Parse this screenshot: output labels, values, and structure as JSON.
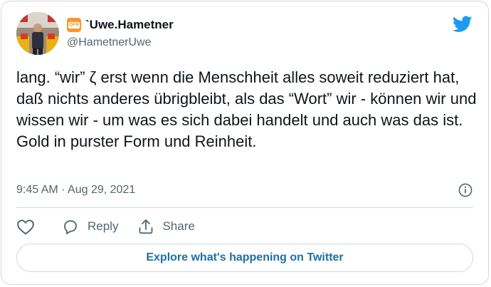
{
  "author": {
    "display_name": "`Uwe.Hametner",
    "handle": "@HametnerUwe",
    "badge_text": "OFF"
  },
  "tweet": {
    "text": "lang. “wir” ζ erst wenn die Menschheit alles soweit reduziert hat, daß nichts anderes übrigbleibt, als das “Wort” wir - können wir und wissen wir - um was es sich dabei handelt und auch was das ist. Gold in purster Form und Reinheit.",
    "timestamp": "9:45 AM · Aug 29, 2021"
  },
  "actions": {
    "reply_label": "Reply",
    "share_label": "Share"
  },
  "cta": {
    "explore_label": "Explore what's happening on Twitter"
  },
  "colors": {
    "twitter_blue": "#1d9bf0",
    "link_blue": "#1d6fa5",
    "secondary_text": "#536471",
    "border": "#cfd9de",
    "badge_orange": "#f59a2b"
  },
  "icons": {
    "logo": "twitter-bird-icon",
    "info": "info-icon",
    "like": "heart-icon",
    "reply": "reply-bubble-icon",
    "share": "share-upload-icon"
  }
}
